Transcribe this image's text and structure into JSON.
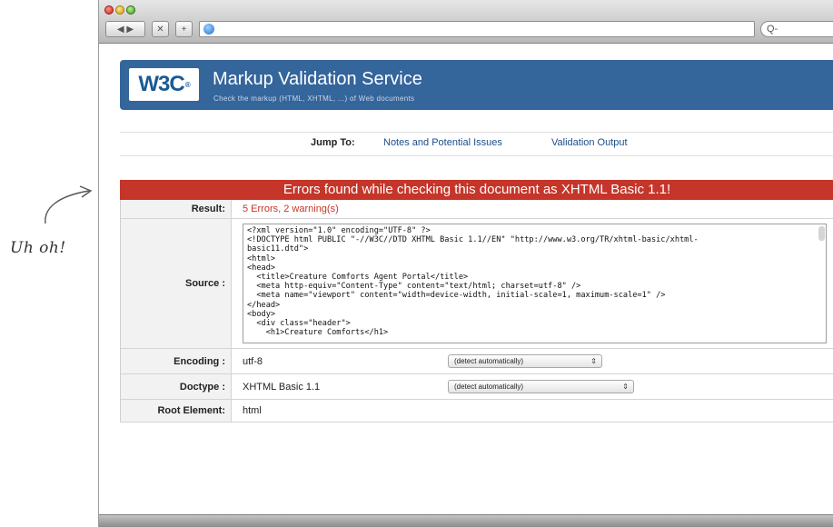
{
  "annotation": {
    "text": "Uh oh!"
  },
  "browser": {
    "back_forward_label": "◀ ▶",
    "stop_label": "✕",
    "add_label": "+",
    "search_placeholder": "Q-"
  },
  "header": {
    "logo_text": "W3C",
    "logo_mark": "®",
    "title": "Markup Validation Service",
    "subtitle": "Check the markup (HTML, XHTML, ...) of Web documents"
  },
  "jump": {
    "label": "Jump To:",
    "links": [
      "Notes and Potential Issues",
      "Validation Output"
    ]
  },
  "banner": {
    "text": "Errors found while checking this document as XHTML Basic 1.1!"
  },
  "results": {
    "result_label": "Result:",
    "result_value": "5 Errors, 2 warning(s)",
    "source_label": "Source :",
    "source_text": "<?xml version=\"1.0\" encoding=\"UTF-8\" ?>\n<!DOCTYPE html PUBLIC \"-//W3C//DTD XHTML Basic 1.1//EN\" \"http://www.w3.org/TR/xhtml-basic/xhtml-\nbasic11.dtd\">\n<html>\n<head>\n  <title>Creature Comforts Agent Portal</title>\n  <meta http-equiv=\"Content-Type\" content=\"text/html; charset=utf-8\" />\n  <meta name=\"viewport\" content=\"width=device-width, initial-scale=1, maximum-scale=1\" />\n</head>\n<body>\n  <div class=\"header\">\n    <h1>Creature Comforts</h1>",
    "encoding_label": "Encoding :",
    "encoding_value": "utf-8",
    "encoding_select": "(detect automatically)",
    "doctype_label": "Doctype :",
    "doctype_value": "XHTML Basic 1.1",
    "doctype_select": "(detect automatically)",
    "root_label": "Root Element:",
    "root_value": "html"
  },
  "colors": {
    "header_blue": "#34659b",
    "error_red": "#c5352a",
    "link_blue": "#1a4d8c"
  }
}
